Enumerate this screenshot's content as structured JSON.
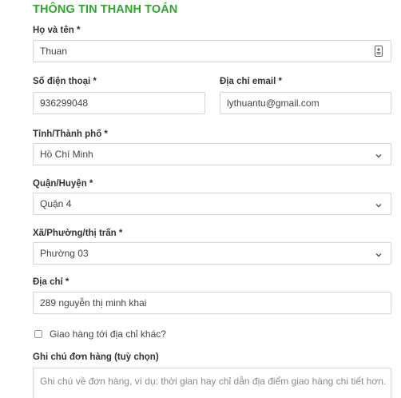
{
  "section_title": "THÔNG TIN THANH TOÁN",
  "fields": {
    "full_name": {
      "label": "Họ và tên *",
      "value": "Thuan"
    },
    "phone": {
      "label": "Số điện thoại *",
      "value": "936299048"
    },
    "email": {
      "label": "Địa chỉ email *",
      "value": "lythuantu@gmail.com"
    },
    "province": {
      "label": "Tỉnh/Thành phố *",
      "value": "Hồ Chí Minh"
    },
    "district": {
      "label": "Quận/Huyện *",
      "value": "Quận 4"
    },
    "ward": {
      "label": "Xã/Phường/thị trấn *",
      "value": "Phường 03"
    },
    "address": {
      "label": "Địa chỉ *",
      "value": "289 nguyễn thị minh khai"
    }
  },
  "ship_different": {
    "label": "Giao hàng tới địa chỉ khác?",
    "checked": false
  },
  "order_notes": {
    "label": "Ghi chú đơn hàng (tuỳ chọn)",
    "placeholder": "Ghi chú về đơn hàng, ví dụ: thời gian hay chỉ dẫn địa điểm giao hàng chi tiết hơn."
  },
  "colors": {
    "accent": "#2fa52f",
    "border": "#d5d5d5",
    "text": "#333333"
  },
  "icons": {
    "name_field": "contact-card-icon",
    "select": "chevron-down-icon"
  }
}
